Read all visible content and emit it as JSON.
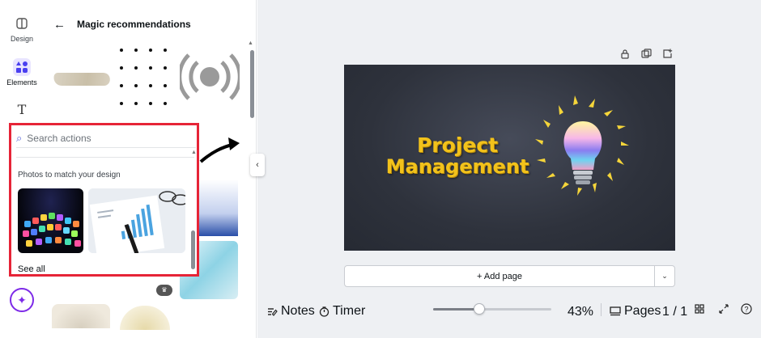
{
  "rail": {
    "items": [
      {
        "label": "Design",
        "icon": "design-icon"
      },
      {
        "label": "Elements",
        "icon": "elements-icon",
        "active": true
      },
      {
        "label": "",
        "icon": "text-icon"
      }
    ]
  },
  "panel": {
    "title": "Magic recommendations",
    "back_icon": "arrow-left-icon"
  },
  "popup": {
    "search_placeholder": "Search actions",
    "section_title": "Photos to match your design",
    "see_all": "See all"
  },
  "slide": {
    "line1": "Project",
    "line2": "Management"
  },
  "canvas": {
    "add_page": "+ Add page"
  },
  "bottom_bar": {
    "notes": "Notes",
    "timer": "Timer",
    "zoom": "43%",
    "zoom_fraction": 0.39,
    "pages": "Pages",
    "page_count": "1 / 1"
  },
  "colors": {
    "highlight": "#e62437",
    "accent": "#7d2ae8",
    "slide_bg": "#2e323c",
    "title_gold": "#f2c21b"
  }
}
